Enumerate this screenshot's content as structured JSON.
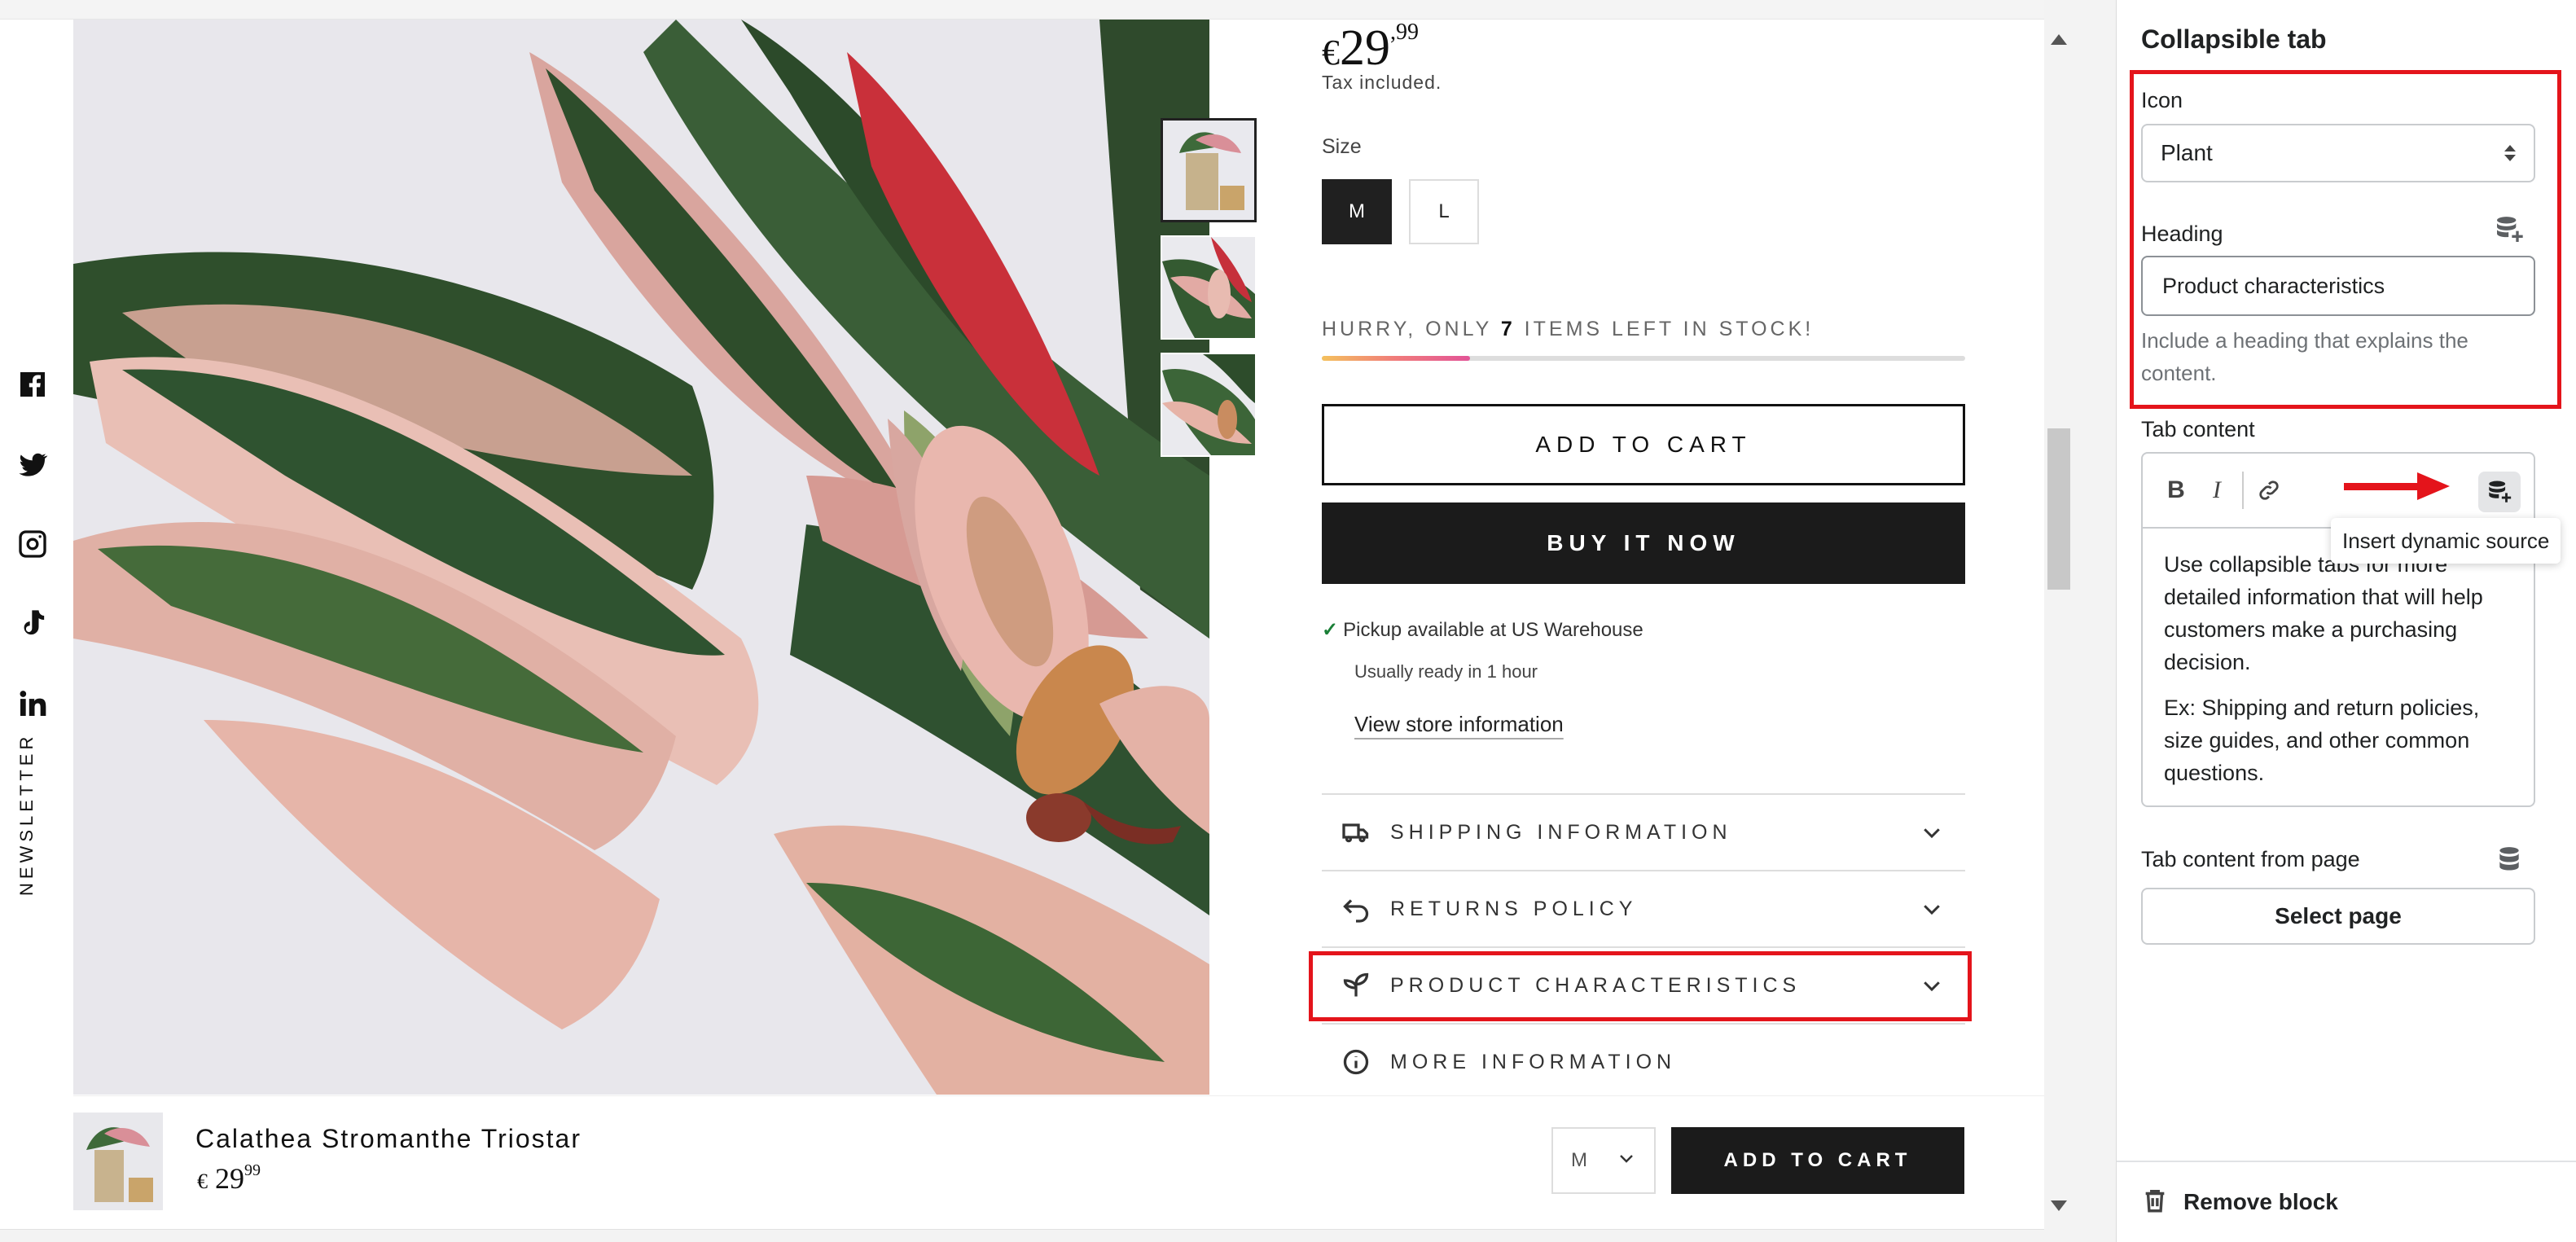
{
  "social": {
    "icons": [
      "facebook-icon",
      "twitter-icon",
      "instagram-icon",
      "tiktok-icon",
      "linkedin-icon"
    ],
    "newsletter": "NEWSLETTER"
  },
  "product": {
    "currency": "€",
    "price_whole": "29",
    "price_cents": ",99",
    "sticky_price_cents": "99",
    "tax_note": "Tax included.",
    "size_label": "Size",
    "sizes": [
      "M",
      "L"
    ],
    "selected_size": "M",
    "stock_prefix": "HURRY, ONLY ",
    "stock_count": "7",
    "stock_suffix": " ITEMS LEFT IN STOCK!",
    "stock_level_fraction": 0.23,
    "add_to_cart": "ADD TO CART",
    "buy_now": "BUY IT NOW",
    "pickup": "Pickup available at US Warehouse",
    "ready": "Usually ready in 1 hour",
    "store_link": "View store information",
    "accordions": [
      {
        "label": "SHIPPING INFORMATION",
        "icon": "truck-icon"
      },
      {
        "label": "RETURNS POLICY",
        "icon": "return-arrow-icon"
      },
      {
        "label": "PRODUCT CHARACTERISTICS",
        "icon": "plant-icon"
      },
      {
        "label": "MORE INFORMATION",
        "icon": "info-icon"
      }
    ]
  },
  "sticky": {
    "name": "Calathea Stromanthe Triostar",
    "size_value": "M",
    "add_to_cart": "ADD TO CART"
  },
  "panel": {
    "title": "Collapsible tab",
    "icon_label": "Icon",
    "icon_value": "Plant",
    "heading_label": "Heading",
    "heading_value": "Product characteristics",
    "heading_help": "Include a heading that explains the content.",
    "tab_content_label": "Tab content",
    "tab_content_p1": "Use collapsible tabs for more detailed information that will help customers make a purchasing decision.",
    "tab_content_p2": "Ex: Shipping and return policies, size guides, and other common questions.",
    "tooltip": "Insert dynamic source",
    "page_label": "Tab content from page",
    "select_page": "Select page",
    "remove_block": "Remove block"
  },
  "colors": {
    "highlight": "#e4141b",
    "button_dark": "#1b1b1b",
    "pickup_check": "#1a7f37"
  }
}
